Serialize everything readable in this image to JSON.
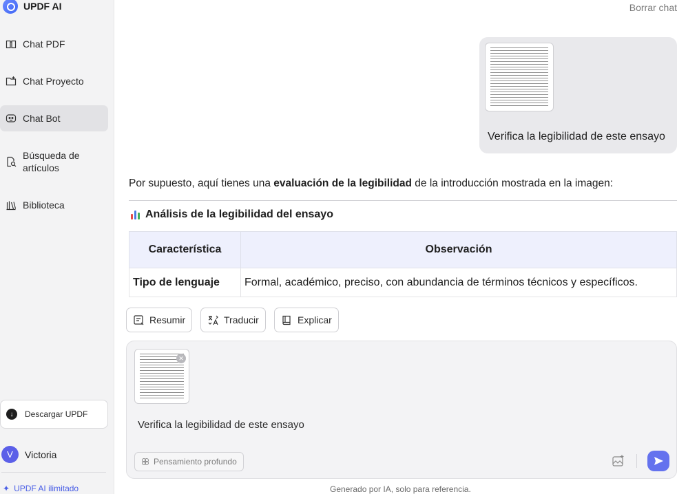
{
  "brand": {
    "name": "UPDF AI"
  },
  "sidebar": {
    "items": [
      {
        "label": "Chat PDF",
        "icon": "book-open-icon"
      },
      {
        "label": "Chat Proyecto",
        "icon": "folder-plus-icon"
      },
      {
        "label": "Chat Bot",
        "icon": "bot-face-icon",
        "active": true
      },
      {
        "label": "Búsqueda de",
        "label2": "artículos",
        "icon": "document-search-icon"
      },
      {
        "label": "Biblioteca",
        "icon": "library-icon"
      }
    ],
    "download_label": "Descargar UPDF",
    "user": {
      "initial": "V",
      "name": "Victoria"
    },
    "upgrade_label": "UPDF AI ilimitado"
  },
  "header": {
    "clear_chat": "Borrar chat"
  },
  "conversation": {
    "user_message": "Verifica la legibilidad de este ensayo",
    "answer": {
      "intro_before": "Por supuesto, aquí tienes una ",
      "intro_bold": "evaluación de la legibilidad",
      "intro_after": " de la introducción mostrada en la imagen:",
      "section_title": "Análisis de la legibilidad del ensayo",
      "table": {
        "headers": [
          "Característica",
          "Observación"
        ],
        "rows": [
          [
            "Tipo de lenguaje",
            "Formal, académico, preciso, con abundancia de términos técnicos y específicos."
          ]
        ]
      }
    }
  },
  "actions": [
    {
      "label": "Resumir",
      "icon": "summary-icon"
    },
    {
      "label": "Traducir",
      "icon": "translate-icon"
    },
    {
      "label": "Explicar",
      "icon": "book-icon"
    }
  ],
  "composer": {
    "text": "Verifica la legibilidad de este ensayo",
    "deep_thinking_label": "Pensamiento profundo"
  },
  "footer": {
    "disclaimer": "Generado por IA, solo para referencia."
  },
  "colors": {
    "accent": "#6472ee",
    "table_header_bg": "#eef0fd",
    "active_nav": "#e2e2e5"
  }
}
